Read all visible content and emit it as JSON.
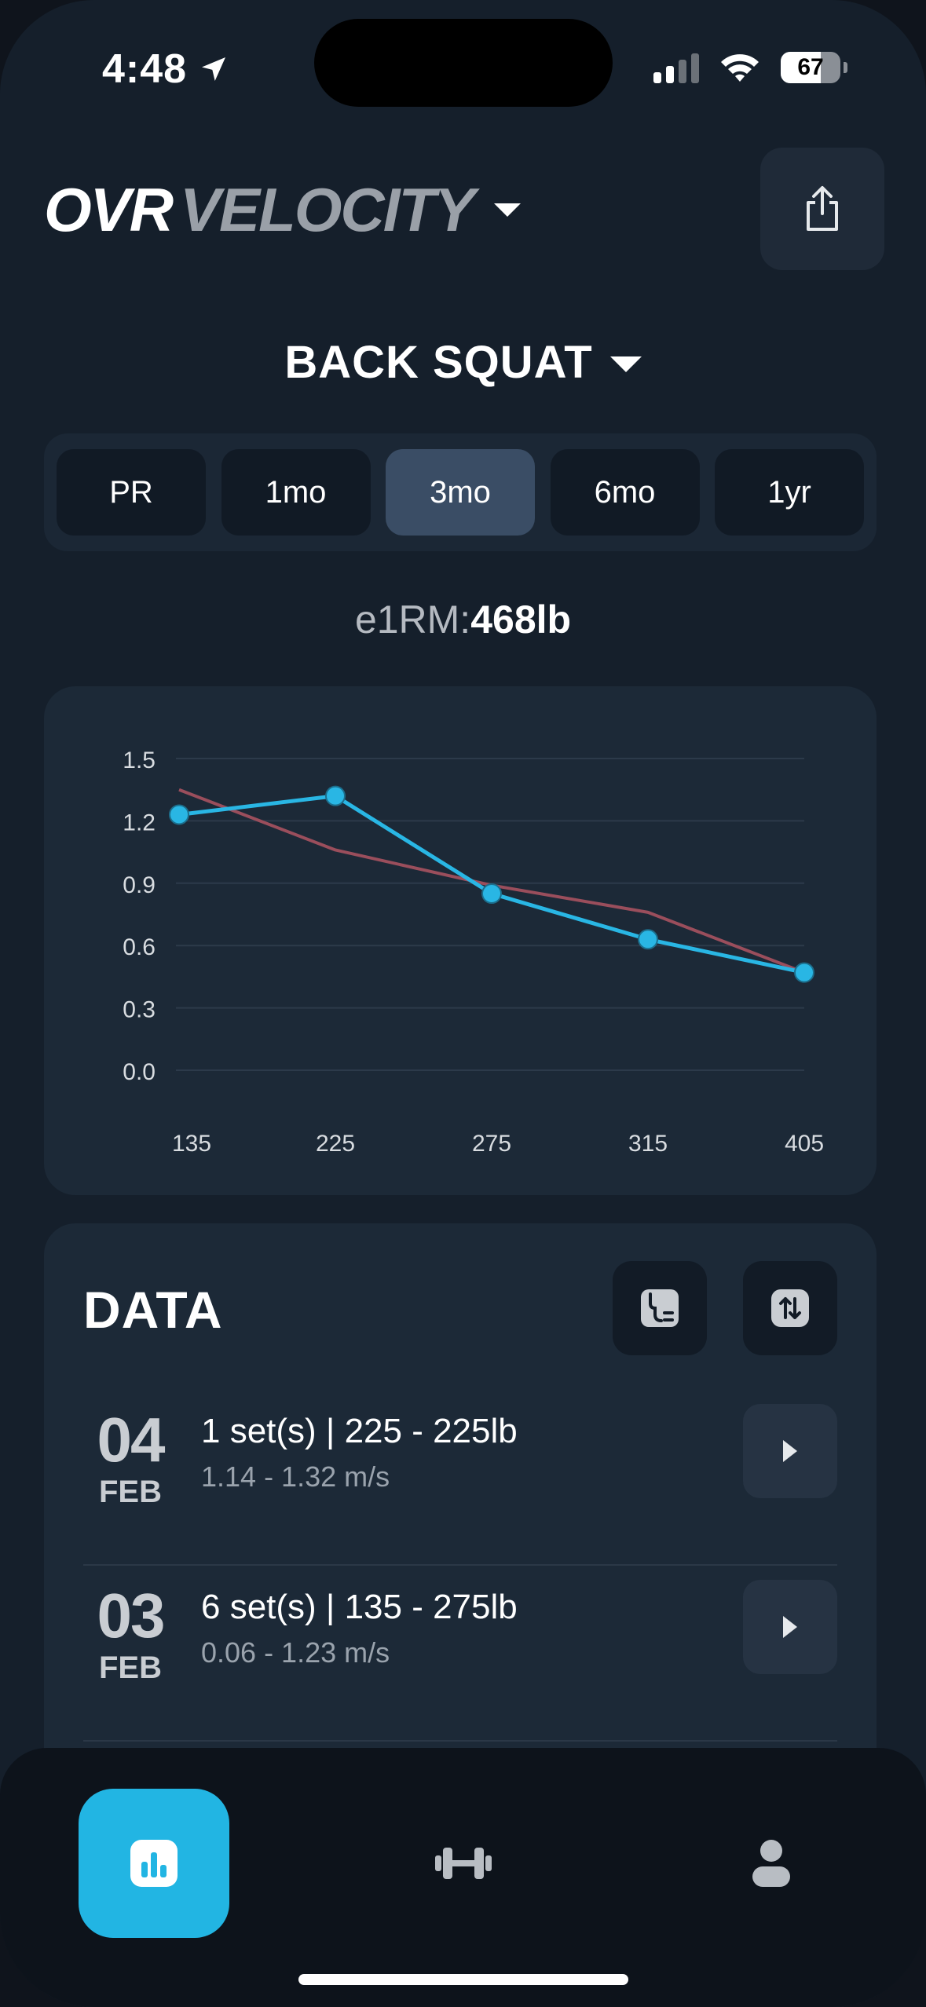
{
  "status": {
    "time": "4:48",
    "battery": "67",
    "battery_level": 0.67
  },
  "header": {
    "logo_primary": "OVR",
    "logo_secondary": "VELOCITY",
    "share_icon": "share-icon"
  },
  "exercise": {
    "name": "BACK SQUAT"
  },
  "range_tabs": [
    {
      "label": "PR",
      "active": false
    },
    {
      "label": "1mo",
      "active": false
    },
    {
      "label": "3mo",
      "active": true
    },
    {
      "label": "6mo",
      "active": false
    },
    {
      "label": "1yr",
      "active": false
    }
  ],
  "e1rm": {
    "label": "e1RM:",
    "value": "468lb"
  },
  "chart_data": {
    "type": "line",
    "categories": [
      "135",
      "225",
      "275",
      "315",
      "405"
    ],
    "y_ticks": [
      "1.5",
      "1.2",
      "0.9",
      "0.6",
      "0.3",
      "0.0"
    ],
    "ylim": [
      0,
      1.5
    ],
    "grid": true,
    "series": [
      {
        "color": "#29b6e4",
        "markers": true,
        "values": [
          1.23,
          1.32,
          0.85,
          0.63,
          0.47
        ]
      },
      {
        "color": "#9a4e5c",
        "markers": false,
        "values": [
          1.35,
          1.06,
          0.89,
          0.76,
          0.47
        ]
      }
    ]
  },
  "data_section": {
    "title": "DATA",
    "sessions": [
      {
        "day": "04",
        "month": "FEB",
        "summary": "1 set(s) | 225 - 225lb",
        "velocity": "1.14 - 1.32 m/s"
      },
      {
        "day": "03",
        "month": "FEB",
        "summary": "6 set(s) | 135 - 275lb",
        "velocity": "0.06 - 1.23 m/s"
      }
    ]
  },
  "nav": {
    "items": [
      {
        "icon": "bar-chart-icon",
        "active": true
      },
      {
        "icon": "dumbbell-icon",
        "active": false
      },
      {
        "icon": "profile-icon",
        "active": false
      }
    ]
  },
  "colors": {
    "accent": "#22b5e3",
    "trend": "#9a4e5c",
    "background": "#151f2b",
    "card": "#1c2937"
  }
}
